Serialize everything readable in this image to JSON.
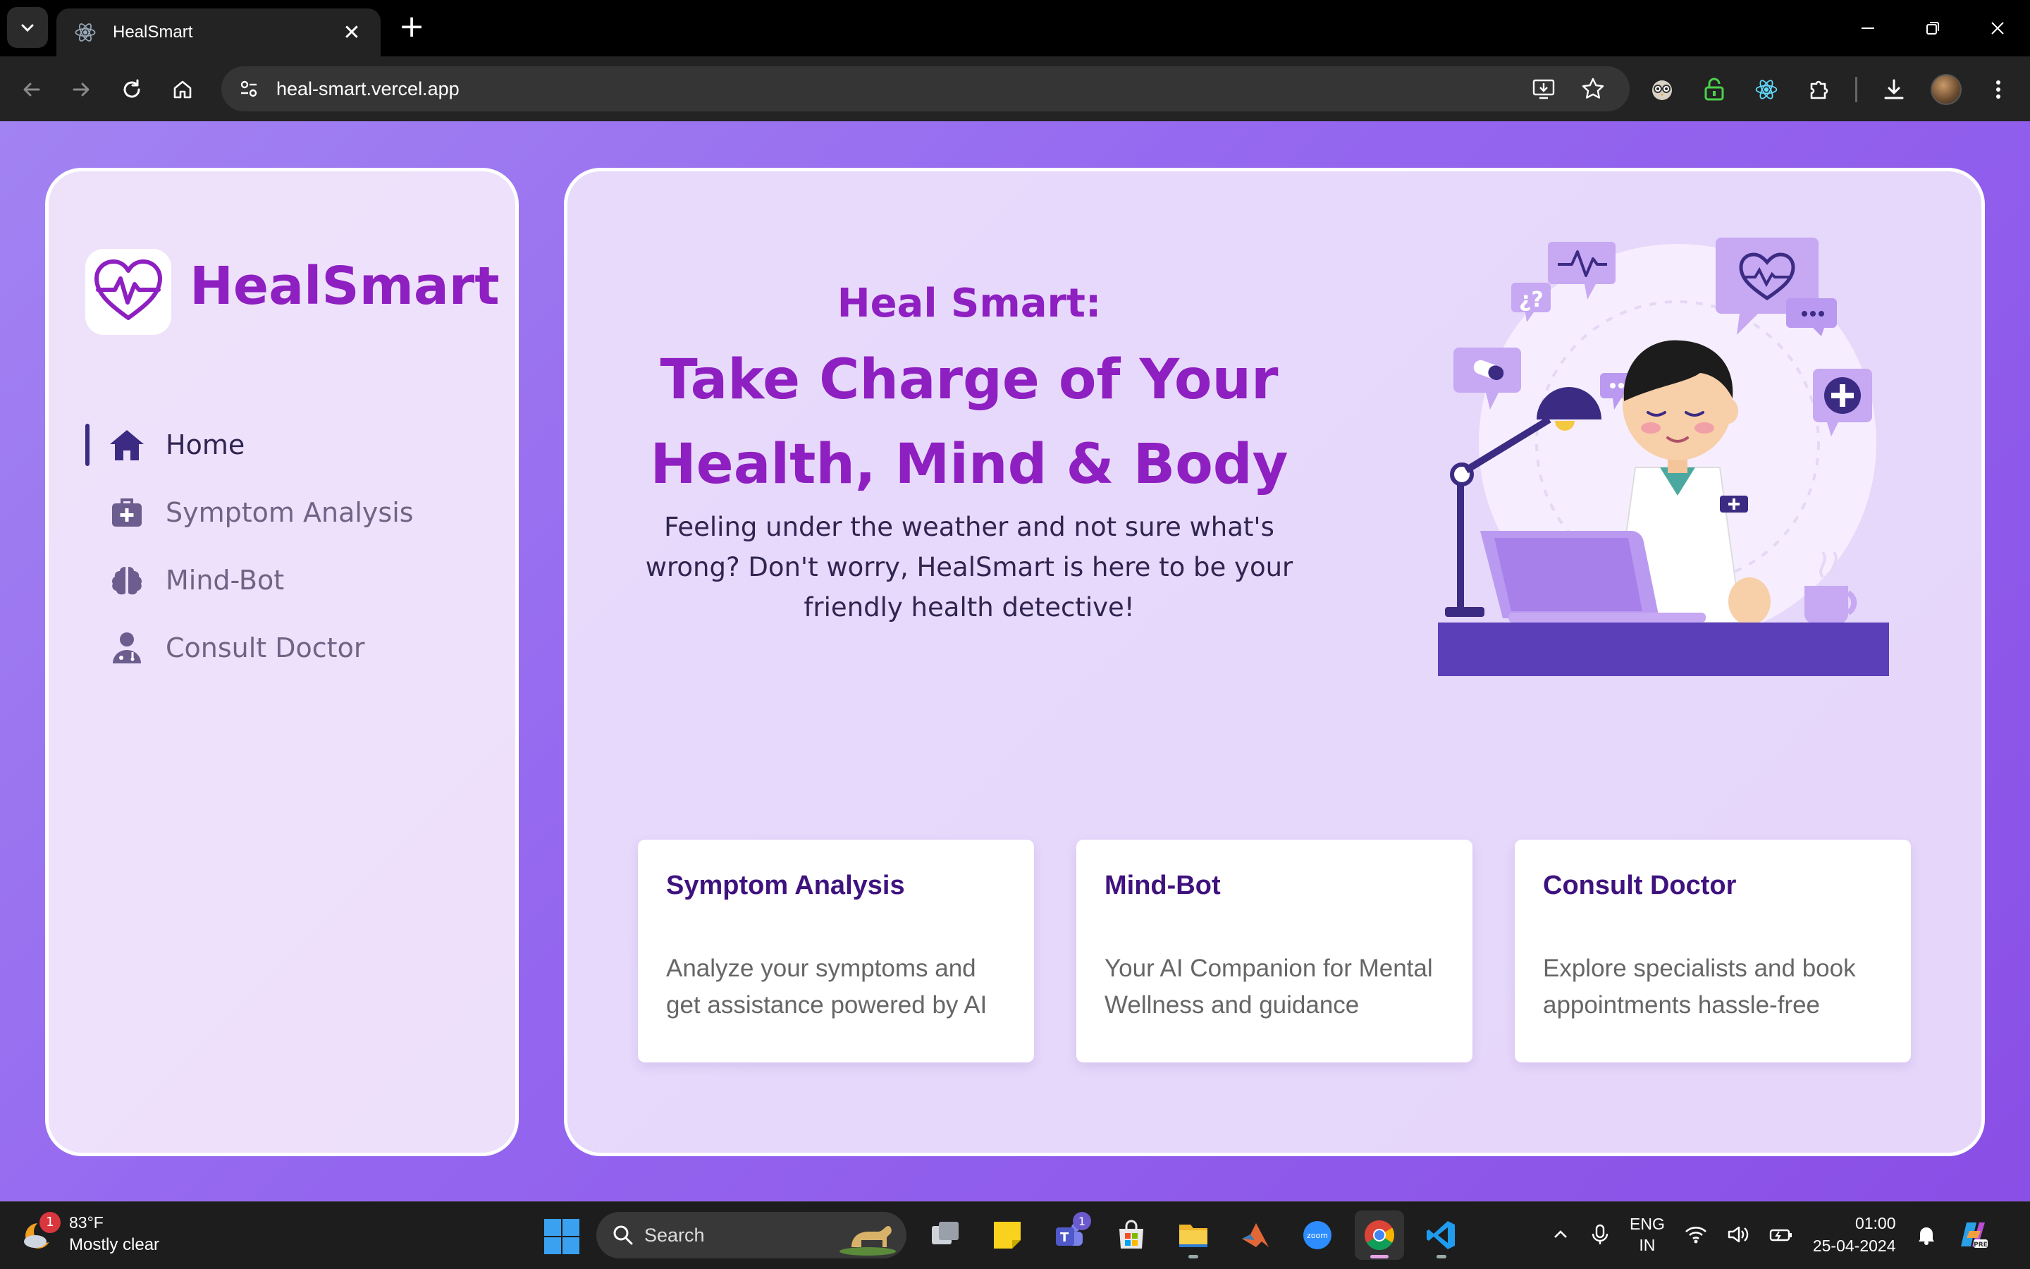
{
  "browser": {
    "tab_title": "HealSmart",
    "url": "heal-smart.vercel.app"
  },
  "sidebar": {
    "brand": "HealSmart",
    "items": [
      {
        "label": "Home",
        "icon": "home-icon",
        "active": true
      },
      {
        "label": "Symptom Analysis",
        "icon": "medkit-icon",
        "active": false
      },
      {
        "label": "Mind-Bot",
        "icon": "brain-icon",
        "active": false
      },
      {
        "label": "Consult Doctor",
        "icon": "doctor-icon",
        "active": false
      }
    ]
  },
  "hero": {
    "pre_title": "Heal Smart:",
    "title_line1": "Take Charge of Your",
    "title_line2": "Health, Mind & Body",
    "description": "Feeling under the weather and not sure what's wrong? Don't worry, HealSmart is here to be your friendly health detective!"
  },
  "cards": [
    {
      "title": "Symptom Analysis",
      "description": "Analyze your symptoms and get assistance powered by AI"
    },
    {
      "title": "Mind-Bot",
      "description": "Your AI Companion for Mental Wellness and guidance"
    },
    {
      "title": "Consult Doctor",
      "description": "Explore specialists and book appointments hassle-free"
    }
  ],
  "taskbar": {
    "weather_badge": "1",
    "weather_temp": "83°F",
    "weather_cond": "Mostly clear",
    "search_label": "Search",
    "teams_badge": "1",
    "lang_line1": "ENG",
    "lang_line2": "IN",
    "time": "01:00",
    "date": "25-04-2024"
  },
  "colors": {
    "brand_purple": "#8e1fc1",
    "card_title": "#3f127e",
    "page_gradient_start": "#a283f2",
    "page_gradient_end": "#8a4fe6"
  }
}
